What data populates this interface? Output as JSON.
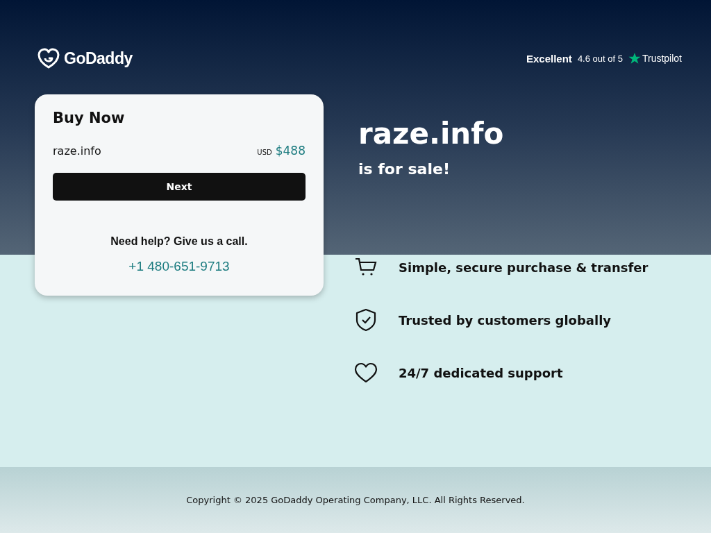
{
  "brand": {
    "name": "GoDaddy"
  },
  "rating": {
    "label": "Excellent",
    "score": "4.6 out of 5",
    "provider": "Trustpilot"
  },
  "buy_card": {
    "title": "Buy Now",
    "domain": "raze.info",
    "currency": "USD",
    "price": "$488",
    "button": "Next",
    "help": "Need help? Give us a call.",
    "phone": "+1 480-651-9713"
  },
  "hero": {
    "domain": "raze.info",
    "subtitle": "is for sale!"
  },
  "features": [
    {
      "kind": "cart",
      "text": "Simple, secure purchase & transfer"
    },
    {
      "kind": "shield",
      "text": "Trusted by customers globally"
    },
    {
      "kind": "heart",
      "text": "24/7 dedicated support"
    }
  ],
  "footer": {
    "copyright": "Copyright © 2025 GoDaddy Operating Company, LLC. All Rights Reserved."
  }
}
